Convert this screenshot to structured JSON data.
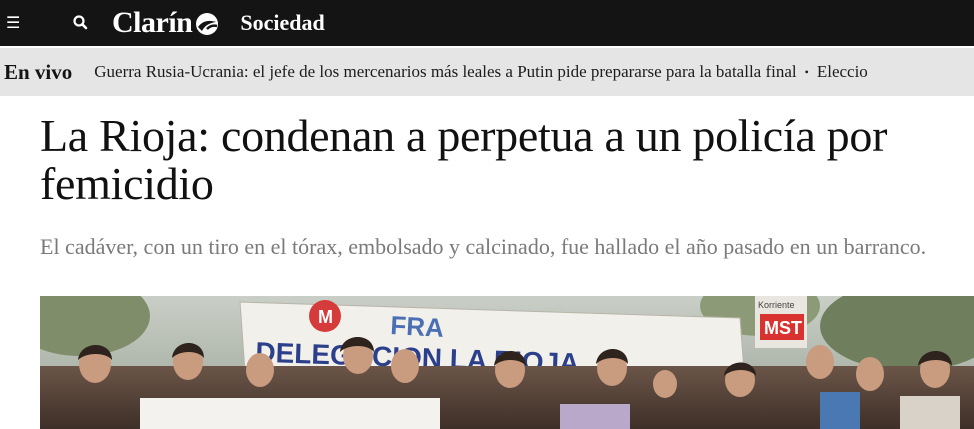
{
  "header": {
    "menu_icon": "hamburger-menu-icon",
    "search_icon": "search-icon",
    "logo_text": "Clarín",
    "section": "Sociedad",
    "background": "#141414"
  },
  "ticker": {
    "live_label": "En vivo",
    "items": [
      "Guerra Rusia-Ucrania: el jefe de los mercenarios más leales a Putin pide prepararse para la batalla final",
      "Eleccio"
    ],
    "separator": "•",
    "background": "#e5e5e5"
  },
  "article": {
    "title": "La Rioja: condenan a perpetua a un policía por femicidio",
    "subtitle": "El cadáver, con un tiro en el tórax, embolsado y calcinado, fue hallado el año pasado en un barranco.",
    "photo": {
      "banner_text_top": "FRA",
      "banner_text_main": "DELEGACION LA RIOJA",
      "sign_top": "Korriente",
      "sign_main": "MST"
    }
  }
}
